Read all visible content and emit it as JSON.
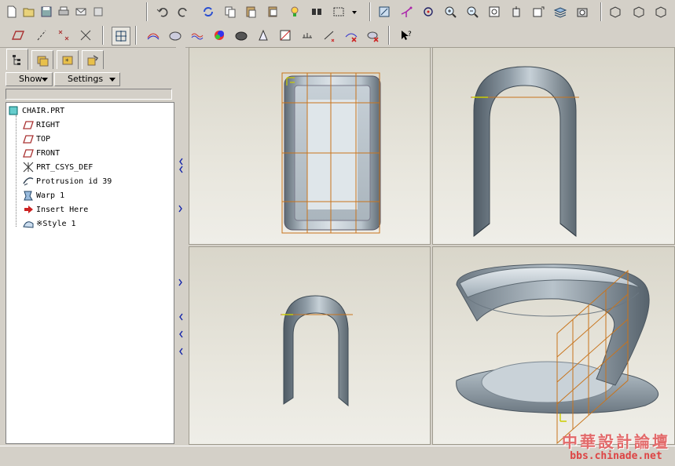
{
  "toolbar_top": {
    "icons": [
      "new-icon",
      "open-icon",
      "save-icon",
      "print-icon",
      "send-icon",
      "erase-icon",
      "undo-icon",
      "redo-icon",
      "regenerate-icon",
      "copy-icon",
      "paste-icon",
      "paste-special-icon",
      "model-tree-bulb-icon",
      "find-icon",
      "select-box-icon",
      "dropdown-icon",
      "sketch-view-icon",
      "datum-csys-icon",
      "spin-center-icon",
      "zoom-in-icon",
      "zoom-out-icon",
      "refit-icon",
      "reorient-icon",
      "saved-views-icon",
      "layers-icon",
      "view-manager-icon",
      "shading-icon",
      "hidden-line-icon",
      "wireframe-icon"
    ]
  },
  "toolbar_second": {
    "icons": [
      "datum-plane-display-icon",
      "datum-axis-display-icon",
      "datum-point-display-icon",
      "csys-display-icon",
      "grid-display-icon",
      "curvature-icon",
      "section-icon",
      "offset-icon",
      "reflection-icon",
      "shade-analysis-icon",
      "draft-icon",
      "slope-icon",
      "dihedral-icon",
      "measure-icon",
      "clear-analysis-icon",
      "remove-all-icon",
      "context-help-icon"
    ]
  },
  "navigator": {
    "tabs": [
      "model-tree-tab",
      "folder-browser-tab",
      "favorites-tab",
      "connections-tab"
    ],
    "show_label": "Show",
    "settings_label": "Settings",
    "tree": [
      {
        "label": "CHAIR.PRT",
        "icon": "part-icon",
        "indent": 0
      },
      {
        "label": "RIGHT",
        "icon": "datum-plane-icon",
        "indent": 1
      },
      {
        "label": "TOP",
        "icon": "datum-plane-icon",
        "indent": 1
      },
      {
        "label": "FRONT",
        "icon": "datum-plane-icon",
        "indent": 1
      },
      {
        "label": "PRT_CSYS_DEF",
        "icon": "csys-icon",
        "indent": 1
      },
      {
        "label": "Protrusion id 39",
        "icon": "protrusion-icon",
        "indent": 1
      },
      {
        "label": "Warp 1",
        "icon": "warp-icon",
        "indent": 1
      },
      {
        "label": "Insert Here",
        "icon": "insert-arrow-icon",
        "indent": 1
      },
      {
        "label": "※Style 1",
        "icon": "style-icon",
        "indent": 1
      }
    ]
  },
  "viewports": {
    "top_left": "top-view",
    "top_right": "front-view",
    "bottom_left": "side-view",
    "bottom_right": "isometric-view"
  },
  "watermark": {
    "chinese": "中華設計論壇",
    "url": "bbs.chinade.net"
  },
  "colors": {
    "chrome": "#d4d0c8",
    "model_steel": "#7f8c99",
    "datum_orange": "#c8741c",
    "watermark_red": "#d44"
  }
}
